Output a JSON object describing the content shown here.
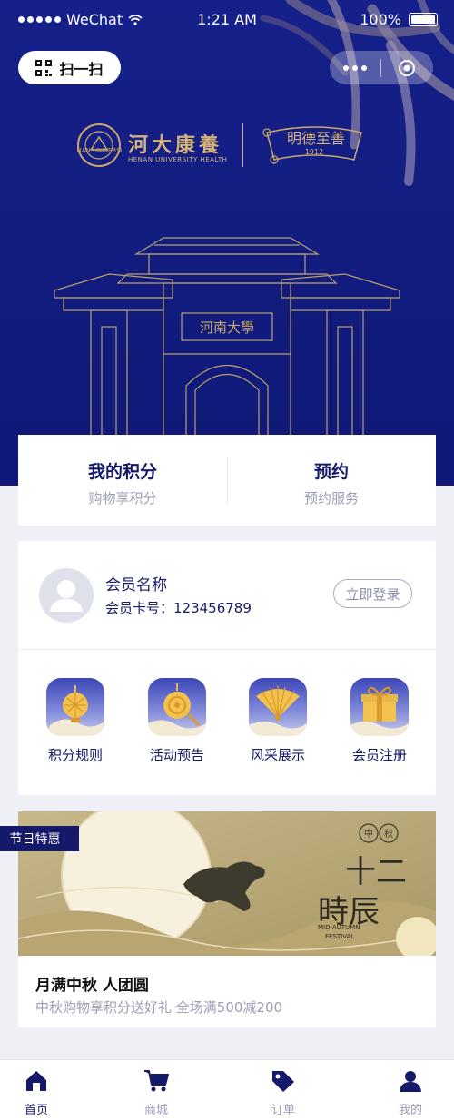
{
  "status_bar": {
    "carrier": "WeChat",
    "time": "1:21 AM",
    "battery": "100%"
  },
  "header": {
    "scan_label": "扫一扫"
  },
  "logos": {
    "primary_text": "河大康養",
    "primary_sub": "HENAN UNIVERSITY HEALTH",
    "seal_text": "HENAN UNIVERSITY",
    "secondary_text": "明德至善",
    "secondary_year": "1912"
  },
  "gate": {
    "plaque": "河南大學"
  },
  "points": {
    "left": {
      "title": "我的积分",
      "subtitle": "购物享积分"
    },
    "right": {
      "title": "预约",
      "subtitle": "预约服务"
    }
  },
  "member": {
    "name": "会员名称",
    "card_number": "会员卡号：123456789",
    "login_label": "立即登录"
  },
  "menu": [
    {
      "label": "积分规则",
      "icon": "lantern-icon"
    },
    {
      "label": "活动预告",
      "icon": "gong-icon"
    },
    {
      "label": "风采展示",
      "icon": "fan-icon"
    },
    {
      "label": "会员注册",
      "icon": "gift-icon"
    }
  ],
  "promo": {
    "tag": "节日特惠",
    "title": "月满中秋 人团圆",
    "subtitle": "中秋购物享积分送好礼  全场满500减200",
    "image_text": {
      "badge_left": "中",
      "badge_right": "秋",
      "headline_1": "十二",
      "headline_2": "時辰",
      "caption_1": "MID-AUTUMN",
      "caption_2": "FESTIVAL"
    }
  },
  "tabbar": [
    {
      "label": "首页",
      "icon": "home-icon",
      "active": true
    },
    {
      "label": "商城",
      "icon": "cart-icon",
      "active": false
    },
    {
      "label": "订单",
      "icon": "tag-icon",
      "active": false
    },
    {
      "label": "我的",
      "icon": "user-icon",
      "active": false
    }
  ],
  "colors": {
    "primary": "#14196a",
    "hero_bg": "#121c7e",
    "gold": "#c9a86a",
    "muted": "#9a9db5",
    "page_bg": "#eef0f5"
  }
}
